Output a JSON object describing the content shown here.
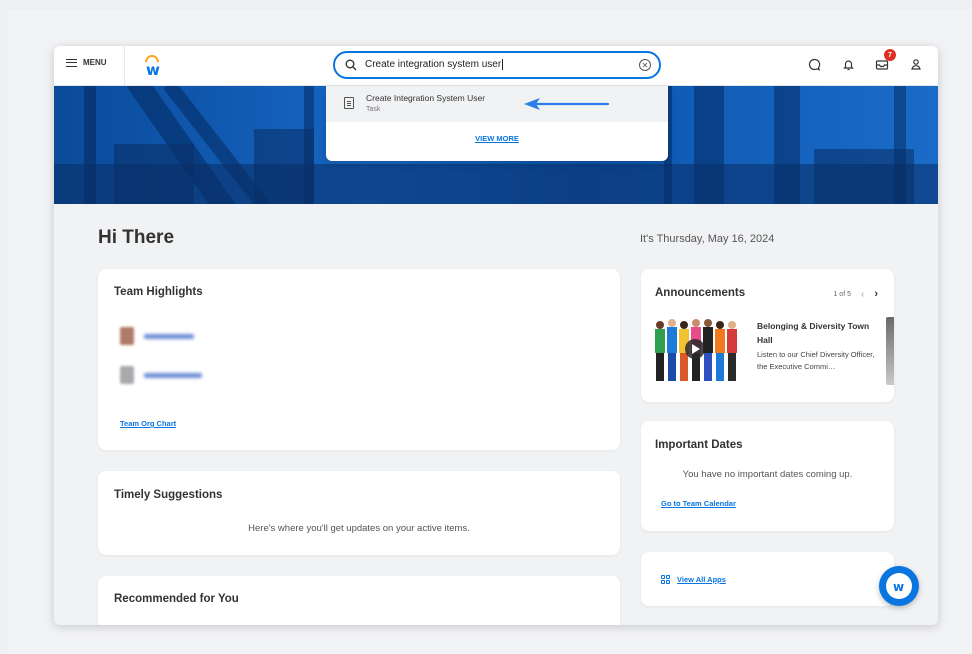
{
  "topbar": {
    "menu_label": "MENU",
    "notification_badge": "7"
  },
  "search": {
    "query": "Create integration system user"
  },
  "dropdown": {
    "result_title": "Create Integration System User",
    "result_type": "Task",
    "view_more": "VIEW MORE"
  },
  "main": {
    "greeting": "Hi There",
    "date": "It's Thursday, May 16, 2024"
  },
  "team_highlights": {
    "title": "Team Highlights",
    "org_chart_link": "Team Org Chart"
  },
  "timely_suggestions": {
    "title": "Timely Suggestions",
    "message": "Here's where you'll get updates on your active items."
  },
  "recommended": {
    "title": "Recommended for You"
  },
  "announcements": {
    "title": "Announcements",
    "pager": "1 of 5",
    "item_title": "Belonging & Diversity Town Hall",
    "item_desc": "Listen to our Chief Diversity Officer, the Executive Commi…"
  },
  "important_dates": {
    "title": "Important Dates",
    "message": "You have no important dates coming up.",
    "calendar_link": "Go to Team Calendar"
  },
  "apps": {
    "view_all": "View All Apps"
  },
  "colors": {
    "accent": "#0875e1",
    "badge": "#de2e21",
    "hero": "#0d55ae"
  }
}
